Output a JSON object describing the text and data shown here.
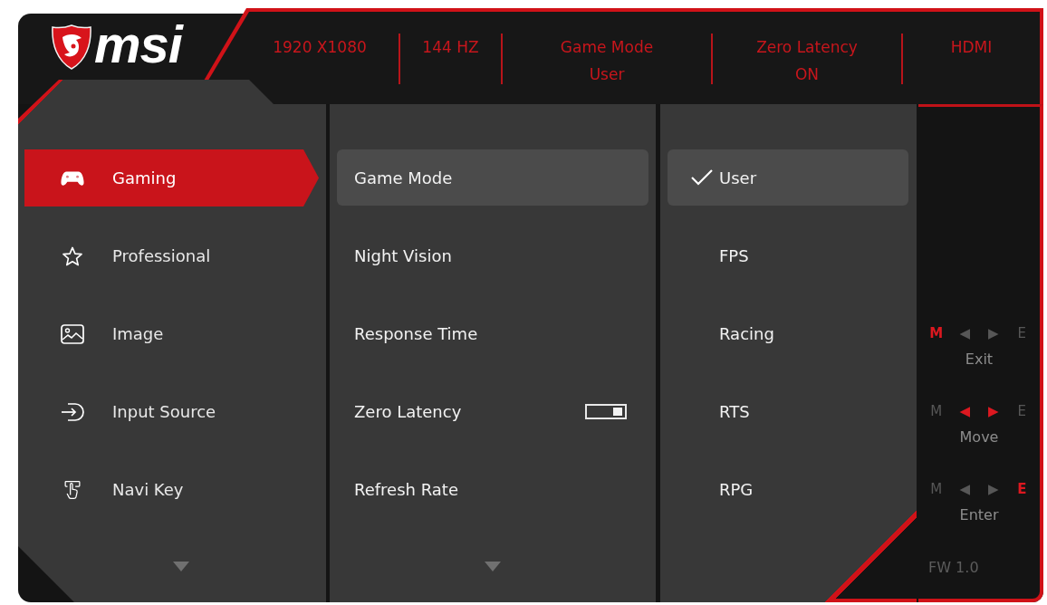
{
  "logo": {
    "wordmark": "msi"
  },
  "status_bar": [
    {
      "label": "1920 X1080"
    },
    {
      "label": "144 HZ"
    },
    {
      "label": "Game Mode",
      "value": "User"
    },
    {
      "label": "Zero Latency",
      "value": "ON"
    },
    {
      "label": "HDMI"
    }
  ],
  "menu": {
    "items": [
      {
        "label": "Gaming",
        "selected": true
      },
      {
        "label": "Professional",
        "selected": false
      },
      {
        "label": "Image",
        "selected": false
      },
      {
        "label": "Input Source",
        "selected": false
      },
      {
        "label": "Navi Key",
        "selected": false
      }
    ]
  },
  "settings": {
    "items": [
      {
        "label": "Game Mode",
        "selected": true
      },
      {
        "label": "Night Vision",
        "selected": false
      },
      {
        "label": "Response Time",
        "selected": false
      },
      {
        "label": "Zero Latency",
        "selected": false,
        "switch": {
          "on": true
        }
      },
      {
        "label": "Refresh Rate",
        "selected": false
      }
    ]
  },
  "options": {
    "items": [
      {
        "label": "User",
        "selected": true,
        "checked": true
      },
      {
        "label": "FPS",
        "selected": false,
        "checked": false
      },
      {
        "label": "Racing",
        "selected": false,
        "checked": false
      },
      {
        "label": "RTS",
        "selected": false,
        "checked": false
      },
      {
        "label": "RPG",
        "selected": false,
        "checked": false
      }
    ]
  },
  "key_guide": {
    "rows": [
      {
        "keys": [
          {
            "label": "M",
            "active": true
          },
          {
            "label": "◀",
            "active": false
          },
          {
            "label": "▶",
            "active": false
          },
          {
            "label": "E",
            "active": false
          }
        ],
        "action": "Exit"
      },
      {
        "keys": [
          {
            "label": "M",
            "active": false
          },
          {
            "label": "◀",
            "active": true
          },
          {
            "label": "▶",
            "active": true
          },
          {
            "label": "E",
            "active": false
          }
        ],
        "action": "Move"
      },
      {
        "keys": [
          {
            "label": "M",
            "active": false
          },
          {
            "label": "◀",
            "active": false
          },
          {
            "label": "▶",
            "active": false
          },
          {
            "label": "E",
            "active": true
          }
        ],
        "action": "Enter"
      }
    ],
    "firmware": "FW 1.0"
  }
}
